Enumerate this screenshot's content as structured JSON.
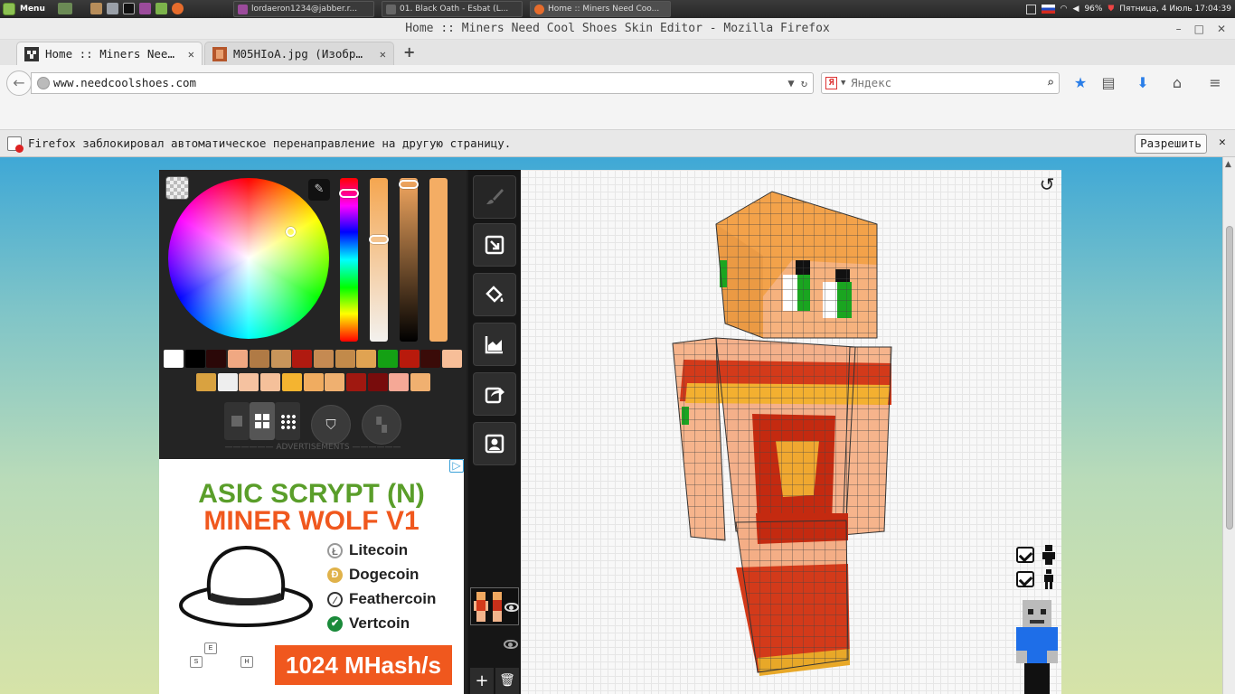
{
  "taskbar": {
    "menu_label": "Menu",
    "tasks": [
      {
        "label": "lordaeron1234@jabber.r..."
      },
      {
        "label": "01. Black Oath - Esbat (L..."
      },
      {
        "label": "Home :: Miners Need Coo..."
      }
    ],
    "battery": "96%",
    "datetime": "Пятница, 4 Июль 17:04:39"
  },
  "window": {
    "title": "Home :: Miners Need Cool Shoes Skin Editor - Mozilla Firefox"
  },
  "tabs": [
    {
      "label": "Home :: Miners Nee…",
      "active": true
    },
    {
      "label": "M05HIoA.jpg (Изобр…",
      "active": false
    }
  ],
  "newtab_label": "+",
  "navbar": {
    "url": "www.needcoolshoes.com",
    "search_engine": "Я",
    "search_placeholder": "Яндекс"
  },
  "notification": {
    "text": "Firefox заблокировал автоматическое перенаправление на другую страницу.",
    "allow_label": "Разрешить"
  },
  "editor": {
    "swatches_row1": [
      "#ffffff",
      "#000000",
      "#2b0808",
      "#f0a882",
      "#b07a45",
      "#c8955a",
      "#b01a10",
      "#c58a52",
      "#c28a4a",
      "#e0a352",
      "#14a014",
      "#b81a0c",
      "#3a0b08",
      "#f7be98"
    ],
    "swatches_row2": [
      "#d9a240",
      "#eeeeee",
      "#f5c2a0",
      "#f5c09a",
      "#f4b430",
      "#f0ac60",
      "#efb070",
      "#a01810",
      "#780c0c",
      "#f5a896",
      "#f0b070"
    ],
    "brush_sizes": [
      "1",
      "2",
      "3"
    ],
    "ads_label": "—————— ADVERTISEMENTS ——————"
  },
  "ad": {
    "headline1": "ASIC SCRYPT (N)",
    "headline2": "MINER WOLF V1",
    "coins": [
      "Litecoin",
      "Dogecoin",
      "Feathercoin",
      "Vertcoin"
    ],
    "hashrate": "1024 MHash/s",
    "keys": [
      "E",
      "S",
      "H"
    ]
  },
  "tools": [
    "brush-icon",
    "select-icon",
    "fill-bucket-icon",
    "chart-icon",
    "share-icon",
    "account-icon"
  ],
  "colors": {
    "accent": "#f0581e",
    "green": "#5a9e2a",
    "panel": "#242424"
  }
}
